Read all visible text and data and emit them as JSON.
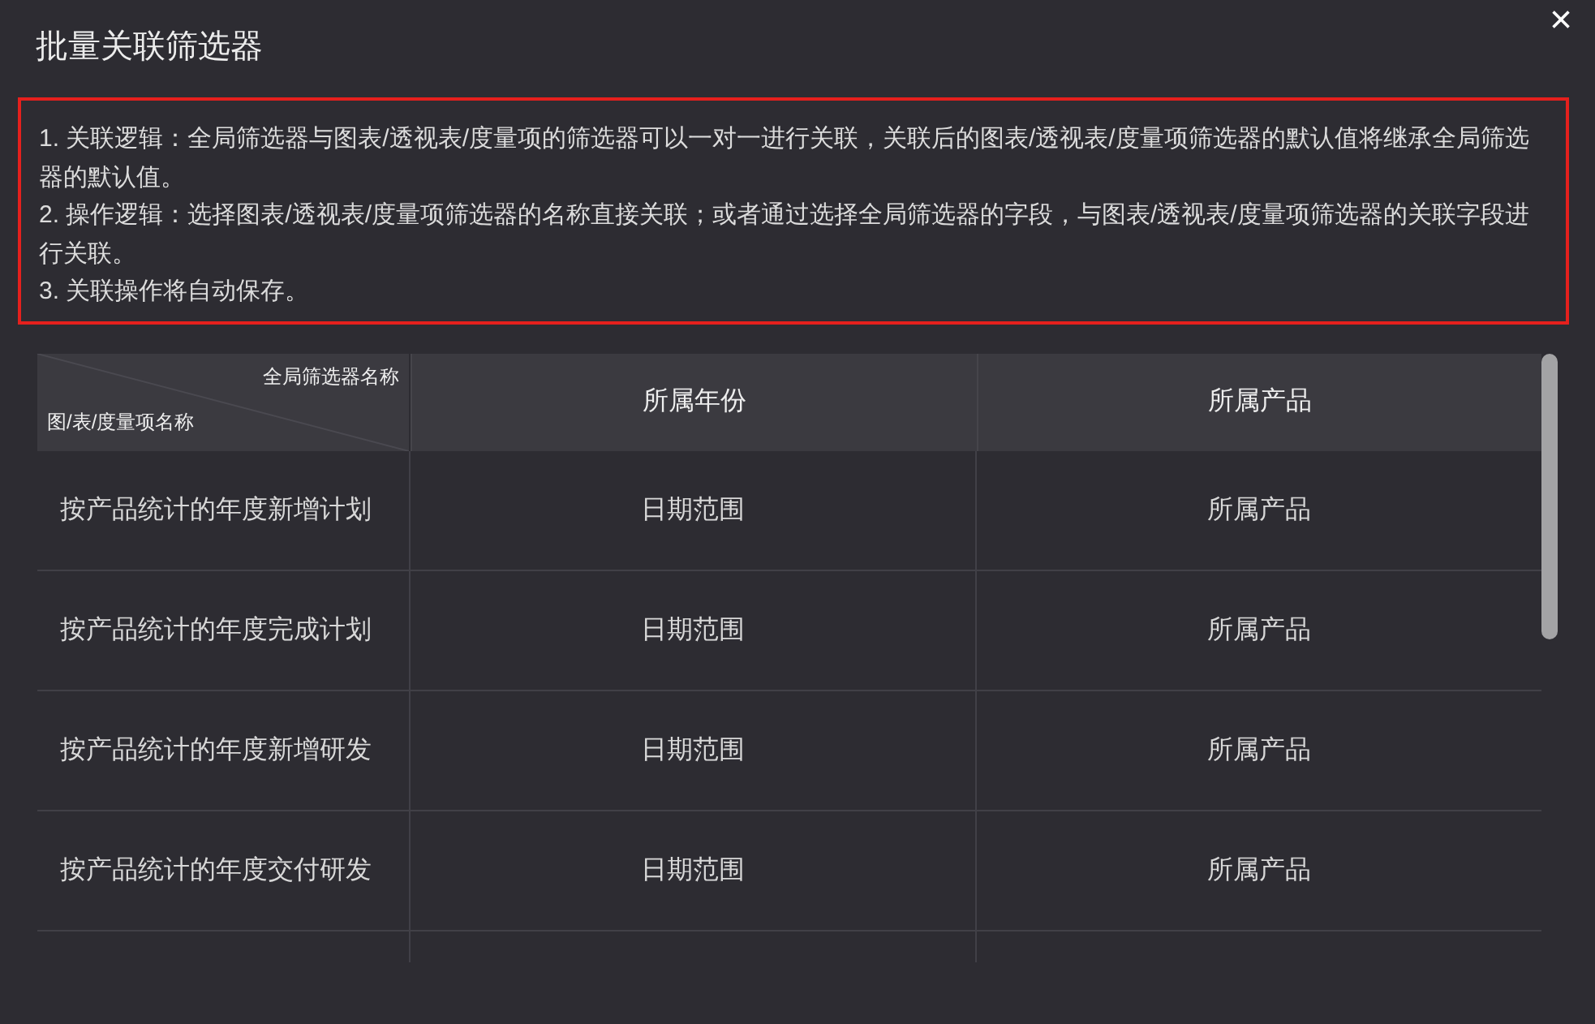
{
  "dialog": {
    "title": "批量关联筛选器",
    "close_icon": "×"
  },
  "notes": [
    "1. 关联逻辑：全局筛选器与图表/透视表/度量项的筛选器可以一对一进行关联，关联后的图表/透视表/度量项筛选器的默认值将继承全局筛选器的默认值。",
    "2. 操作逻辑：选择图表/透视表/度量项筛选器的名称直接关联；或者通过选择全局筛选器的字段，与图表/透视表/度量项筛选器的关联字段进行关联。",
    "3. 关联操作将自动保存。"
  ],
  "table": {
    "corner": {
      "top_label": "全局筛选器名称",
      "bottom_label": "图/表/度量项名称"
    },
    "columns": [
      "所属年份",
      "所属产品"
    ],
    "rows": [
      {
        "name": "按产品统计的年度新增计划",
        "cells": [
          "日期范围",
          "所属产品"
        ]
      },
      {
        "name": "按产品统计的年度完成计划",
        "cells": [
          "日期范围",
          "所属产品"
        ]
      },
      {
        "name": "按产品统计的年度新增研发",
        "cells": [
          "日期范围",
          "所属产品"
        ]
      },
      {
        "name": "按产品统计的年度交付研发",
        "cells": [
          "日期范围",
          "所属产品"
        ]
      }
    ]
  }
}
